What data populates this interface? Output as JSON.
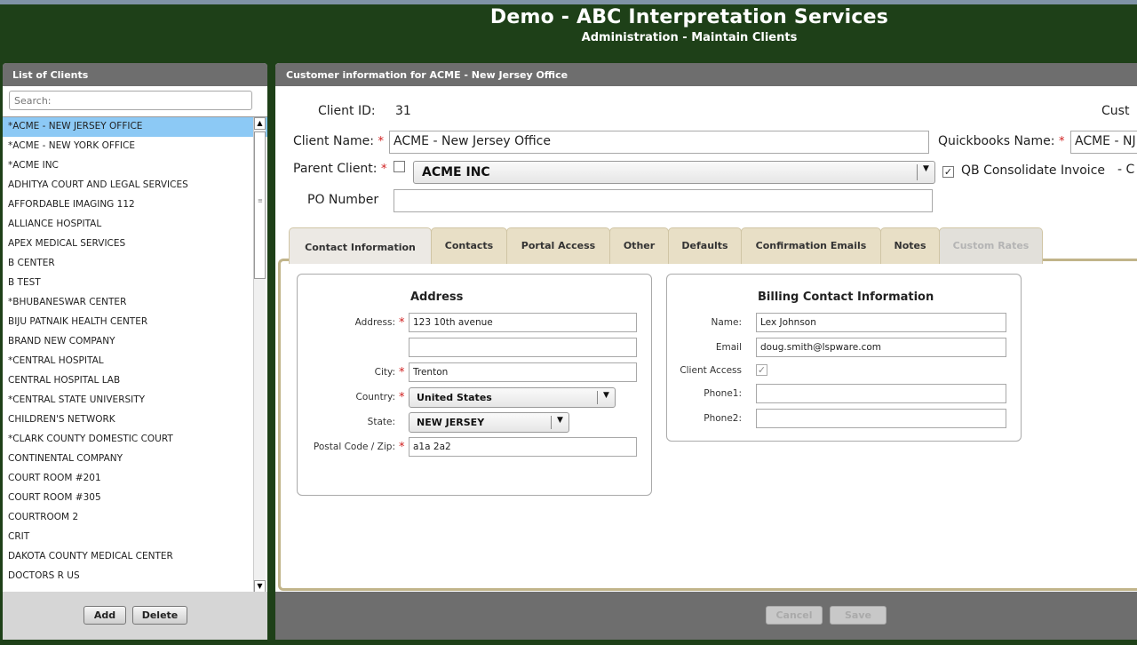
{
  "header": {
    "title": "Demo - ABC Interpretation Services",
    "subtitle": "Administration - Maintain Clients"
  },
  "left_panel": {
    "title": "List of Clients",
    "search_placeholder": "Search:",
    "clients": [
      "*ACME - NEW JERSEY OFFICE",
      "*ACME - NEW YORK OFFICE",
      "*ACME INC",
      "ADHITYA COURT AND LEGAL SERVICES",
      "AFFORDABLE IMAGING 112",
      "ALLIANCE HOSPITAL",
      "APEX MEDICAL SERVICES",
      "B CENTER",
      "B TEST",
      "*BHUBANESWAR CENTER",
      "BIJU PATNAIK HEALTH CENTER",
      "BRAND NEW COMPANY",
      "*CENTRAL HOSPITAL",
      "CENTRAL HOSPITAL LAB",
      "*CENTRAL STATE UNIVERSITY",
      "CHILDREN'S NETWORK",
      "*CLARK COUNTY DOMESTIC COURT",
      "CONTINENTAL COMPANY",
      "COURT ROOM #201",
      "COURT ROOM #305",
      "COURTROOM 2",
      "CRIT",
      "DAKOTA COUNTY MEDICAL CENTER",
      "DOCTORS R US"
    ],
    "selected_index": 0,
    "add_label": "Add",
    "delete_label": "Delete",
    "scroll_up_icon": "triangle-up",
    "scroll_down_icon": "triangle-down"
  },
  "right_panel": {
    "title": "Customer information for ACME - New Jersey Office",
    "client_id_label": "Client ID:",
    "client_id_value": "31",
    "cust_label_partial": "Cust",
    "client_name_label": "Client Name:",
    "client_name_value": "ACME - New Jersey Office",
    "quickbooks_label": "Quickbooks Name:",
    "quickbooks_value": "ACME - NJ",
    "parent_client_label": "Parent Client:",
    "parent_client_value": "ACME INC",
    "qb_consolidate_label": "QB Consolidate Invoice",
    "qb_consolidate_checked": true,
    "trailing_partial": "- C",
    "po_number_label": "PO Number",
    "po_number_value": "",
    "required_mark": "*",
    "tabs": [
      {
        "label": "Contact Information",
        "state": "active"
      },
      {
        "label": "Contacts",
        "state": "normal"
      },
      {
        "label": "Portal Access",
        "state": "normal"
      },
      {
        "label": "Other",
        "state": "normal"
      },
      {
        "label": "Defaults",
        "state": "normal"
      },
      {
        "label": "Confirmation Emails",
        "state": "normal"
      },
      {
        "label": "Notes",
        "state": "normal"
      },
      {
        "label": "Custom Rates",
        "state": "disabled"
      }
    ],
    "address": {
      "title": "Address",
      "address_label": "Address:",
      "address_line1": "123 10th avenue",
      "address_line2": "",
      "city_label": "City:",
      "city_value": "Trenton",
      "country_label": "Country:",
      "country_value": "United States",
      "state_label": "State:",
      "state_value": "NEW JERSEY",
      "postal_label": "Postal Code / Zip:",
      "postal_value": "a1a 2a2"
    },
    "billing": {
      "title": "Billing Contact Information",
      "name_label": "Name:",
      "name_value": "Lex Johnson",
      "email_label": "Email",
      "email_value": "doug.smith@lspware.com",
      "client_access_label": "Client Access",
      "client_access_checked": true,
      "phone1_label": "Phone1:",
      "phone1_value": "",
      "phone2_label": "Phone2:",
      "phone2_value": ""
    },
    "cancel_label": "Cancel",
    "save_label": "Save"
  },
  "colors": {
    "background": "#1e4018",
    "panel_header": "#6e6e6e",
    "selected_row": "#8cc9f5",
    "tab_bg": "#e8dfc6",
    "tab_border": "#c1b48a",
    "required": "#d02020"
  }
}
